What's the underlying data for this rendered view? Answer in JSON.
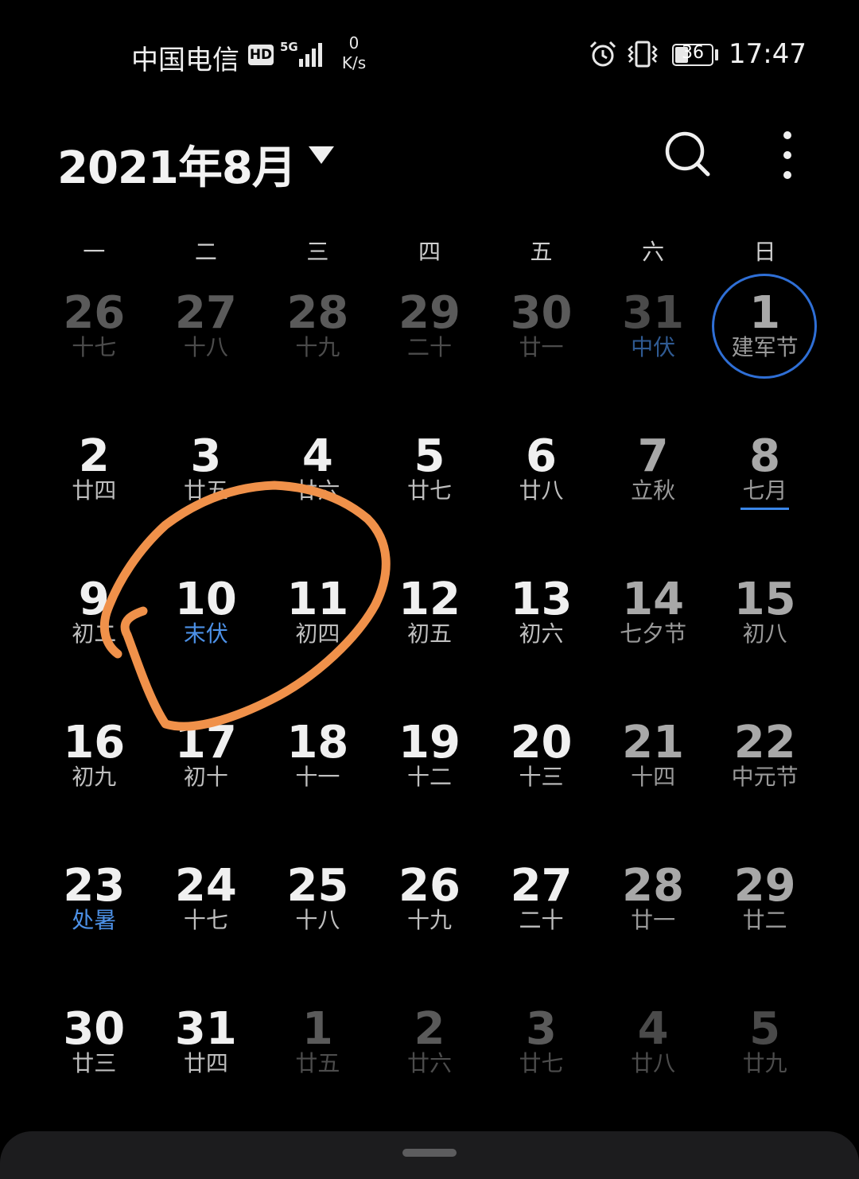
{
  "status_bar": {
    "carrier": "中国电信",
    "hd_badge": "HD",
    "network": "5G",
    "speed_value": "0",
    "speed_unit": "K/s",
    "battery": "36",
    "time": "17:47"
  },
  "header": {
    "month_title": "2021年8月",
    "caret_icon": "caret-down-icon",
    "search_icon": "search-icon",
    "more_icon": "more-vertical-icon"
  },
  "weekdays": [
    "一",
    "二",
    "三",
    "四",
    "五",
    "六",
    "日"
  ],
  "weeks": [
    [
      {
        "day": "26",
        "lunar": "十七",
        "current_month": false
      },
      {
        "day": "27",
        "lunar": "十八",
        "current_month": false
      },
      {
        "day": "28",
        "lunar": "十九",
        "current_month": false
      },
      {
        "day": "29",
        "lunar": "二十",
        "current_month": false
      },
      {
        "day": "30",
        "lunar": "廿一",
        "current_month": false
      },
      {
        "day": "31",
        "lunar": "中伏",
        "current_month": false,
        "highlight": true
      },
      {
        "day": "1",
        "lunar": "建军节",
        "current_month": true,
        "highlight": true,
        "today": true
      }
    ],
    [
      {
        "day": "2",
        "lunar": "廿四",
        "current_month": true
      },
      {
        "day": "3",
        "lunar": "廿五",
        "current_month": true
      },
      {
        "day": "4",
        "lunar": "廿六",
        "current_month": true
      },
      {
        "day": "5",
        "lunar": "廿七",
        "current_month": true
      },
      {
        "day": "6",
        "lunar": "廿八",
        "current_month": true
      },
      {
        "day": "7",
        "lunar": "立秋",
        "current_month": true,
        "highlight": true
      },
      {
        "day": "8",
        "lunar": "七月",
        "current_month": true,
        "underline": true
      }
    ],
    [
      {
        "day": "9",
        "lunar": "初二",
        "current_month": true
      },
      {
        "day": "10",
        "lunar": "末伏",
        "current_month": true,
        "highlight": true
      },
      {
        "day": "11",
        "lunar": "初四",
        "current_month": true
      },
      {
        "day": "12",
        "lunar": "初五",
        "current_month": true
      },
      {
        "day": "13",
        "lunar": "初六",
        "current_month": true
      },
      {
        "day": "14",
        "lunar": "七夕节",
        "current_month": true,
        "highlight": true
      },
      {
        "day": "15",
        "lunar": "初八",
        "current_month": true
      }
    ],
    [
      {
        "day": "16",
        "lunar": "初九",
        "current_month": true
      },
      {
        "day": "17",
        "lunar": "初十",
        "current_month": true
      },
      {
        "day": "18",
        "lunar": "十一",
        "current_month": true
      },
      {
        "day": "19",
        "lunar": "十二",
        "current_month": true
      },
      {
        "day": "20",
        "lunar": "十三",
        "current_month": true
      },
      {
        "day": "21",
        "lunar": "十四",
        "current_month": true
      },
      {
        "day": "22",
        "lunar": "中元节",
        "current_month": true,
        "highlight": true
      }
    ],
    [
      {
        "day": "23",
        "lunar": "处暑",
        "current_month": true,
        "highlight": true
      },
      {
        "day": "24",
        "lunar": "十七",
        "current_month": true
      },
      {
        "day": "25",
        "lunar": "十八",
        "current_month": true
      },
      {
        "day": "26",
        "lunar": "十九",
        "current_month": true
      },
      {
        "day": "27",
        "lunar": "二十",
        "current_month": true
      },
      {
        "day": "28",
        "lunar": "廿一",
        "current_month": true
      },
      {
        "day": "29",
        "lunar": "廿二",
        "current_month": true
      }
    ],
    [
      {
        "day": "30",
        "lunar": "廿三",
        "current_month": true
      },
      {
        "day": "31",
        "lunar": "廿四",
        "current_month": true
      },
      {
        "day": "1",
        "lunar": "廿五",
        "current_month": false
      },
      {
        "day": "2",
        "lunar": "廿六",
        "current_month": false
      },
      {
        "day": "3",
        "lunar": "廿七",
        "current_month": false
      },
      {
        "day": "4",
        "lunar": "廿八",
        "current_month": false
      },
      {
        "day": "5",
        "lunar": "廿九",
        "current_month": false
      }
    ]
  ],
  "colors": {
    "accent": "#2f6fd6",
    "festival_text": "#4c90e6",
    "annotation_stroke": "#f0914a"
  }
}
